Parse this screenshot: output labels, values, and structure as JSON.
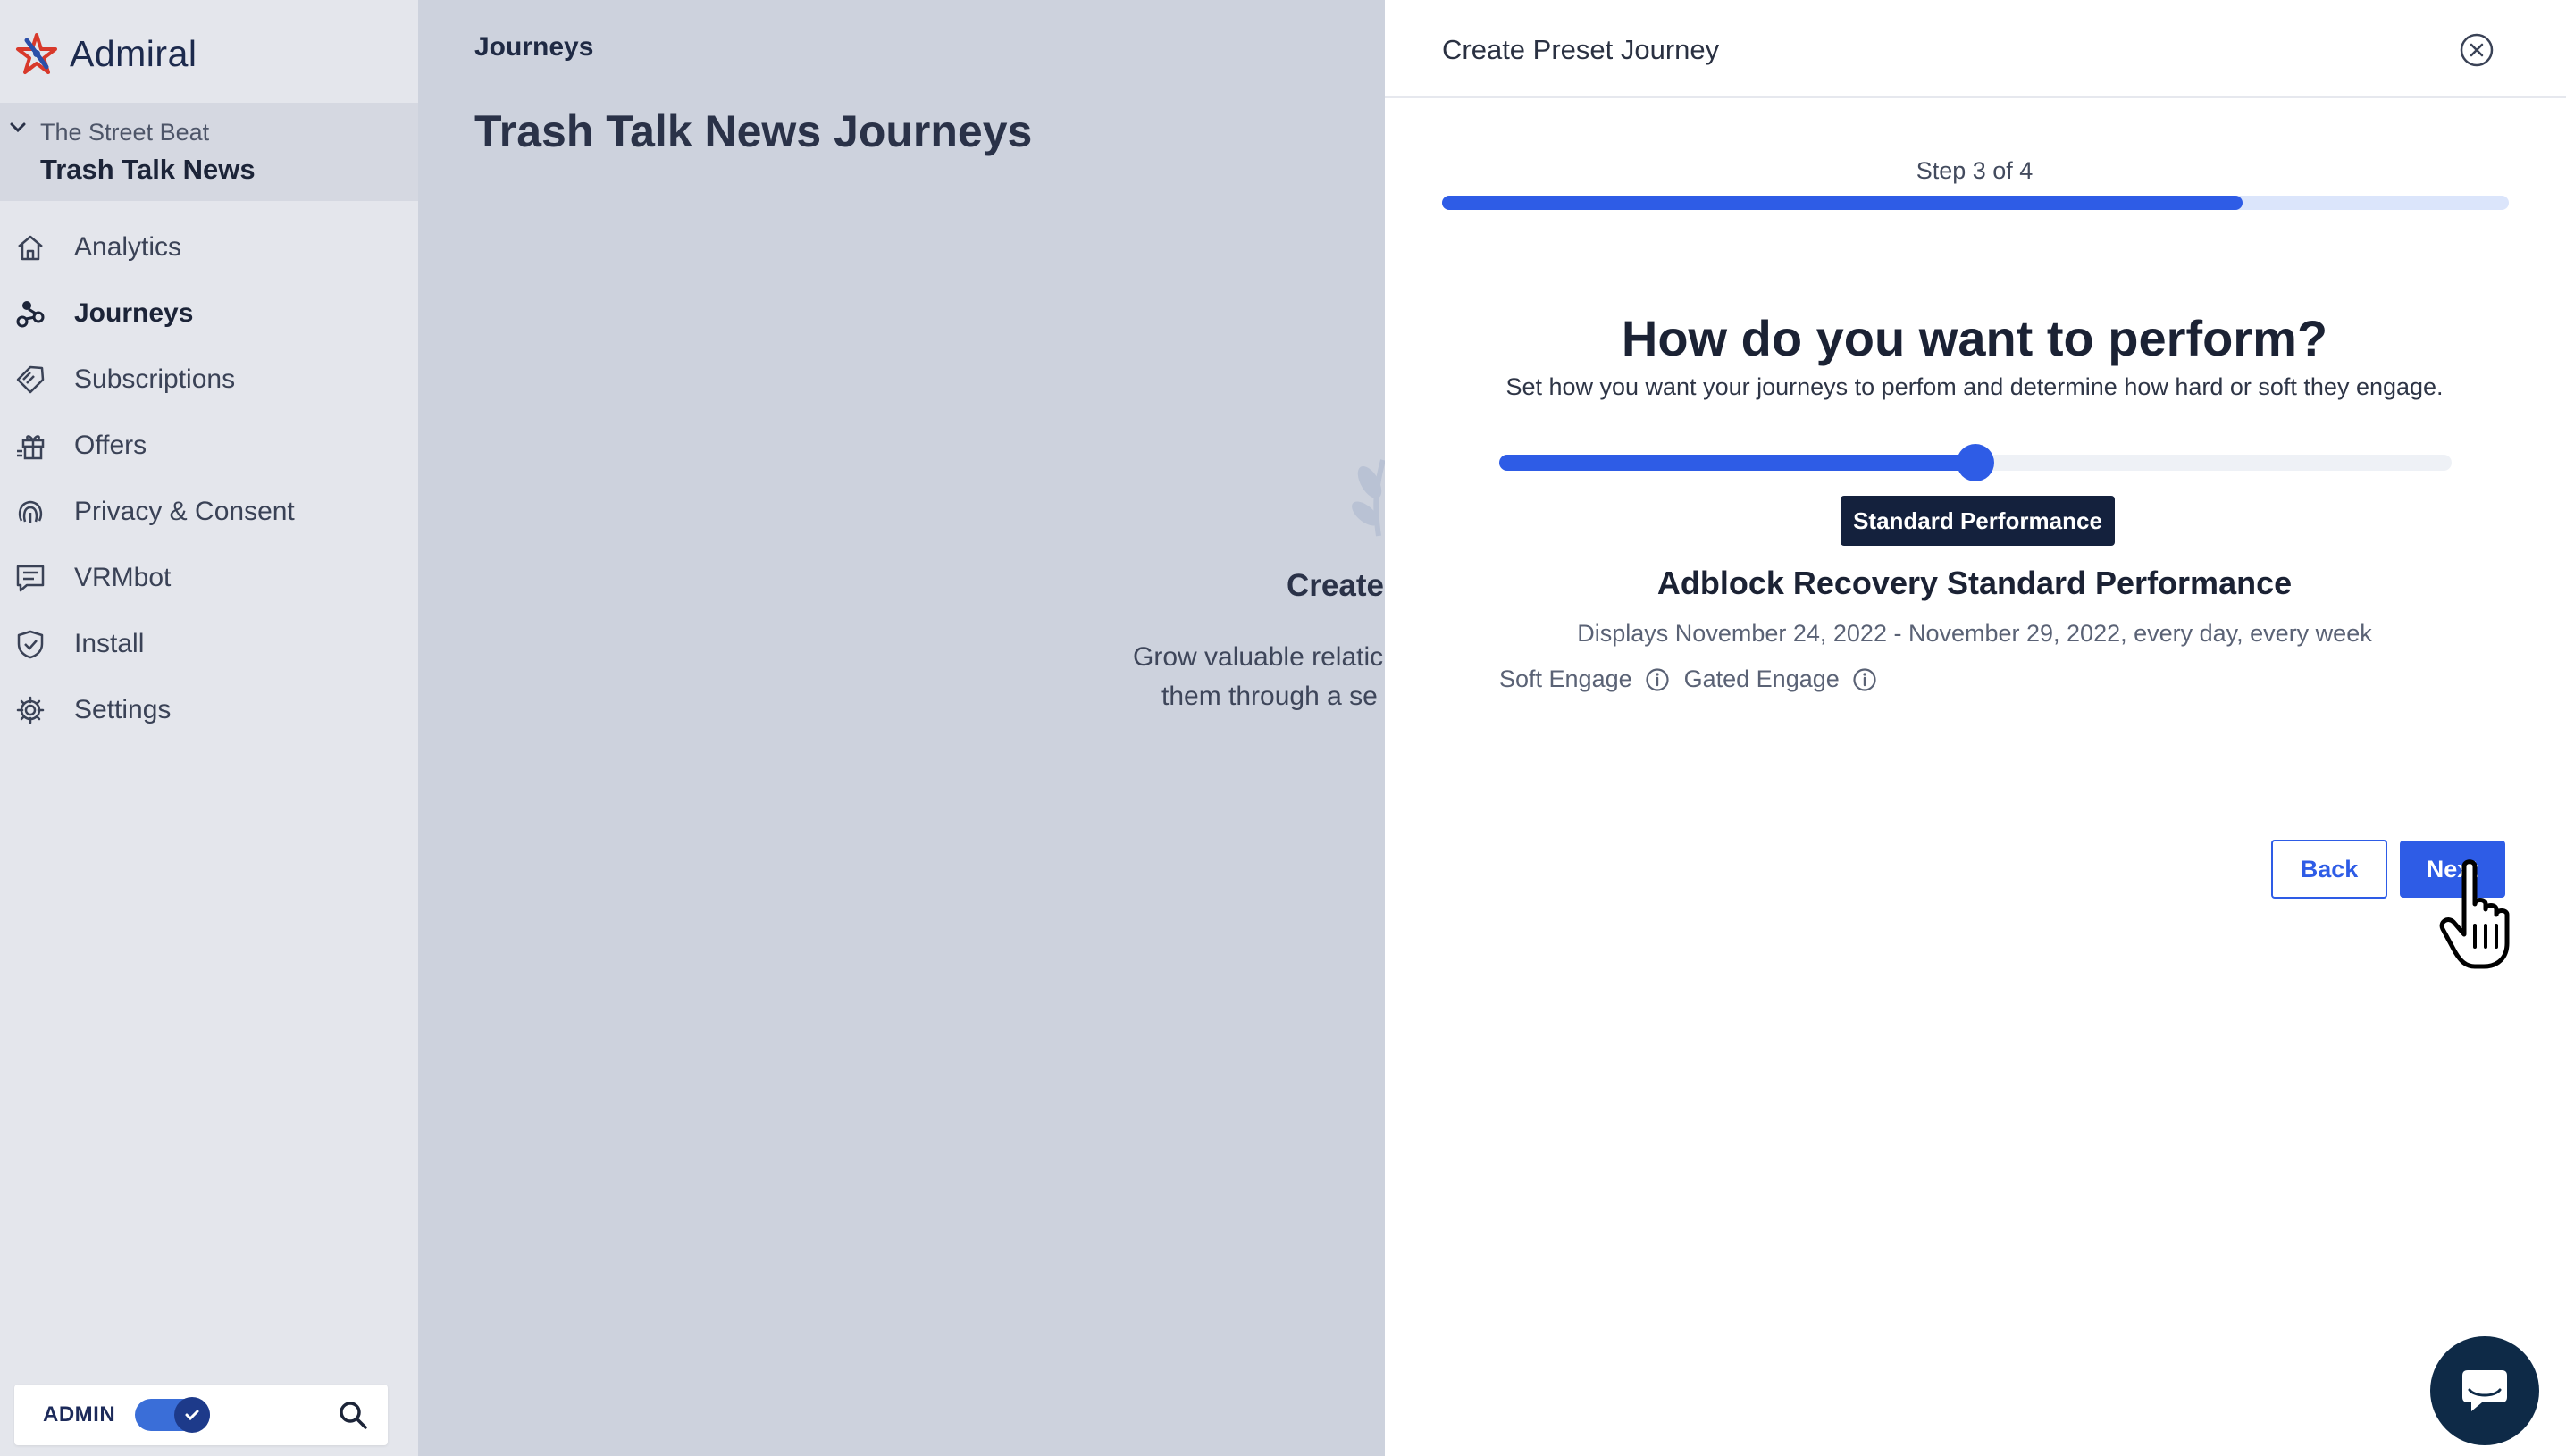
{
  "app": {
    "name": "Admiral"
  },
  "sidebar": {
    "org_parent": "The Street Beat",
    "org_name": "Trash Talk News",
    "items": [
      {
        "label": "Analytics",
        "icon": "home-icon",
        "active": false
      },
      {
        "label": "Journeys",
        "icon": "journeys-icon",
        "active": true
      },
      {
        "label": "Subscriptions",
        "icon": "tag-icon",
        "active": false
      },
      {
        "label": "Offers",
        "icon": "gift-icon",
        "active": false
      },
      {
        "label": "Privacy & Consent",
        "icon": "fingerprint-icon",
        "active": false
      },
      {
        "label": "VRMbot",
        "icon": "chat-list-icon",
        "active": false
      },
      {
        "label": "Install",
        "icon": "shield-check-icon",
        "active": false
      },
      {
        "label": "Settings",
        "icon": "gear-icon",
        "active": false
      }
    ],
    "admin_label": "ADMIN",
    "admin_toggle_on": true
  },
  "main": {
    "breadcrumb": "Journeys",
    "title": "Trash Talk News Journeys",
    "empty_title": "Create",
    "empty_line1": "Grow valuable relatic",
    "empty_line2": "them through a se"
  },
  "drawer": {
    "title": "Create Preset Journey",
    "step_label": "Step 3 of 4",
    "progress": 0.75,
    "question": "How do you want to perform?",
    "subtitle": "Set how you want your journeys to perfom and determine how hard or soft they engage.",
    "slider_value": 0.5,
    "badge": "Standard Performance",
    "preset_name": "Adblock Recovery Standard Performance",
    "schedule": "Displays November 24, 2022 - November 29, 2022, every day, every week",
    "engage_soft": "Soft Engage",
    "engage_gated": "Gated Engage",
    "back_label": "Back",
    "next_label": "Next"
  },
  "colors": {
    "accent": "#2e5ce6",
    "navy": "#14213d",
    "sidebar_bg": "#e4e6ec",
    "overlay_bg": "#cdd2dd"
  }
}
